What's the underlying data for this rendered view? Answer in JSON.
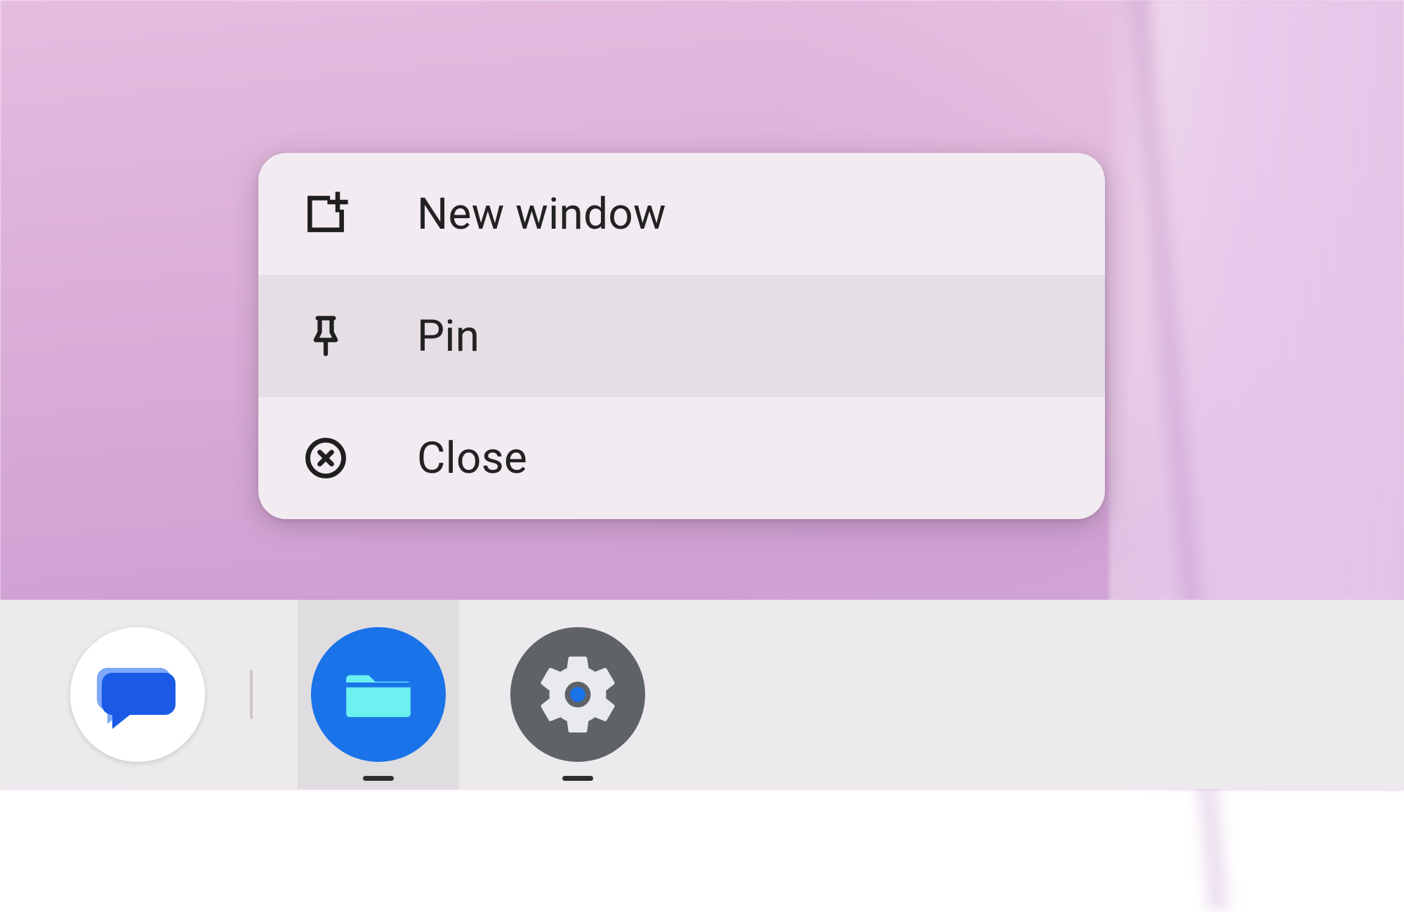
{
  "context_menu": {
    "items": [
      {
        "label": "New window",
        "icon": "new-window",
        "highlight": false
      },
      {
        "label": "Pin",
        "icon": "pin",
        "highlight": true
      },
      {
        "label": "Close",
        "icon": "close-circle",
        "highlight": false
      }
    ]
  },
  "taskbar": {
    "apps": [
      {
        "name": "messages",
        "active": false,
        "running_indicator": false
      },
      {
        "name": "files",
        "active": true,
        "running_indicator": true
      },
      {
        "name": "settings",
        "active": false,
        "running_indicator": true
      }
    ]
  }
}
